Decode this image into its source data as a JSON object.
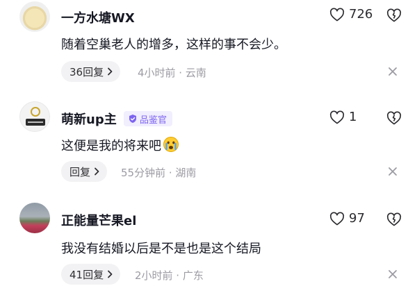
{
  "comments": [
    {
      "username": "一方水塘WX",
      "text": "随着空巢老人的增多，这样的事不会少。",
      "reply_label": "36回复",
      "meta": "4小时前 · 云南",
      "likes": "726"
    },
    {
      "username": "萌新up主",
      "badge": "品鉴官",
      "text": "这便是我的将来吧",
      "reply_label": "回复",
      "meta": "55分钟前 · 湖南",
      "likes": "1"
    },
    {
      "username": "正能量芒果el",
      "text": "我没有结婚以后是不是也是这个结局",
      "reply_label": "41回复",
      "meta": "2小时前 · 广东",
      "likes": "97"
    }
  ],
  "icons": {
    "like": "heart-outline-icon",
    "dislike": "broken-heart-icon",
    "close": "close-icon",
    "reply_chevron": "chevron-right-icon",
    "badge": "verified-badge-icon",
    "emoji": "crying-face-emoji"
  },
  "colors": {
    "badge_text": "#7d64f0",
    "badge_bg": "#f1eefe",
    "meta": "#9b9ba3",
    "reply_bg": "#f2f2f4"
  }
}
